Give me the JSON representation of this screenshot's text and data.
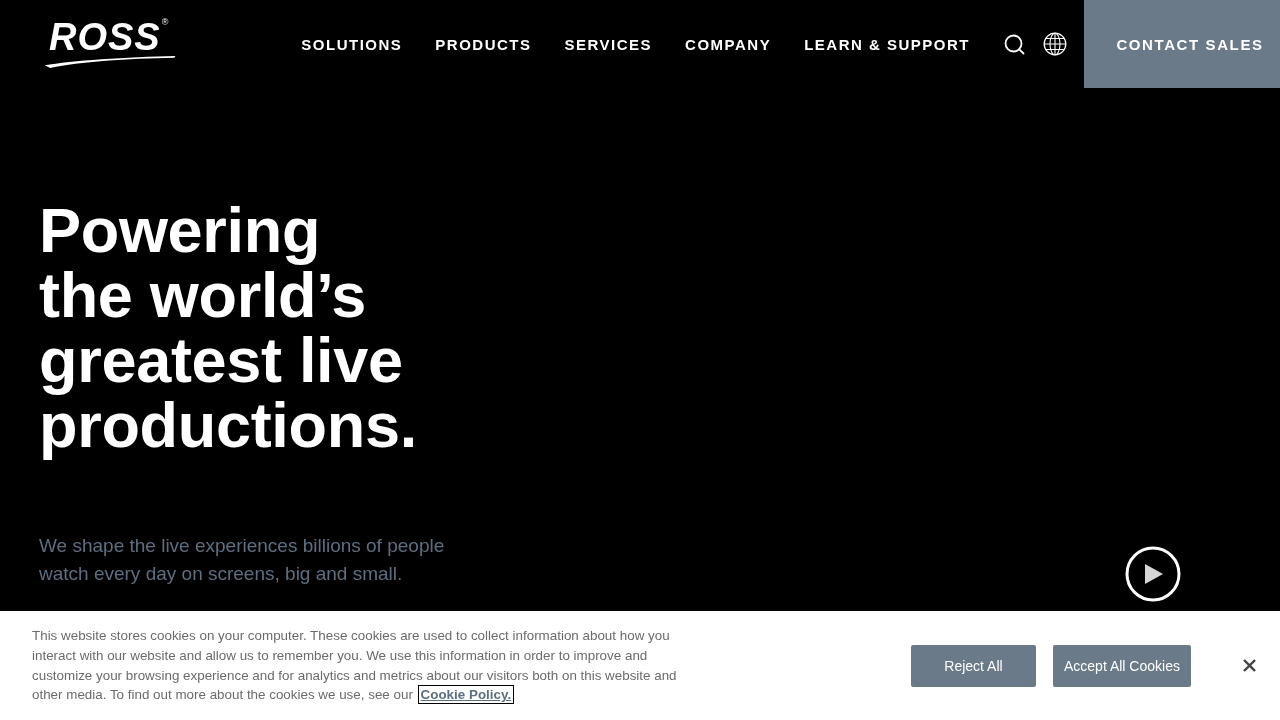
{
  "header": {
    "logo": {
      "text": "ROSS",
      "mark": "®"
    },
    "nav": [
      "SOLUTIONS",
      "PRODUCTS",
      "SERVICES",
      "COMPANY",
      "LEARN & SUPPORT"
    ],
    "cta": "CONTACT SALES"
  },
  "hero": {
    "heading_lines": [
      "Powering",
      "the world’s",
      "greatest live",
      "productions."
    ],
    "subtitle_lines": [
      "We shape the live experiences billions of people",
      "watch every day on screens, big and small."
    ]
  },
  "cookie_banner": {
    "text": "This website stores cookies on your computer. These cookies are used to collect information about how you interact with our website and allow us to remember you. We use this information in order to improve and customize your browsing experience and for analytics and metrics about our visitors both on this website and other media. To find out more about the cookies we use, see our",
    "link": "Cookie Policy.",
    "buttons": [
      "Reject All",
      "Accept All Cookies"
    ]
  }
}
